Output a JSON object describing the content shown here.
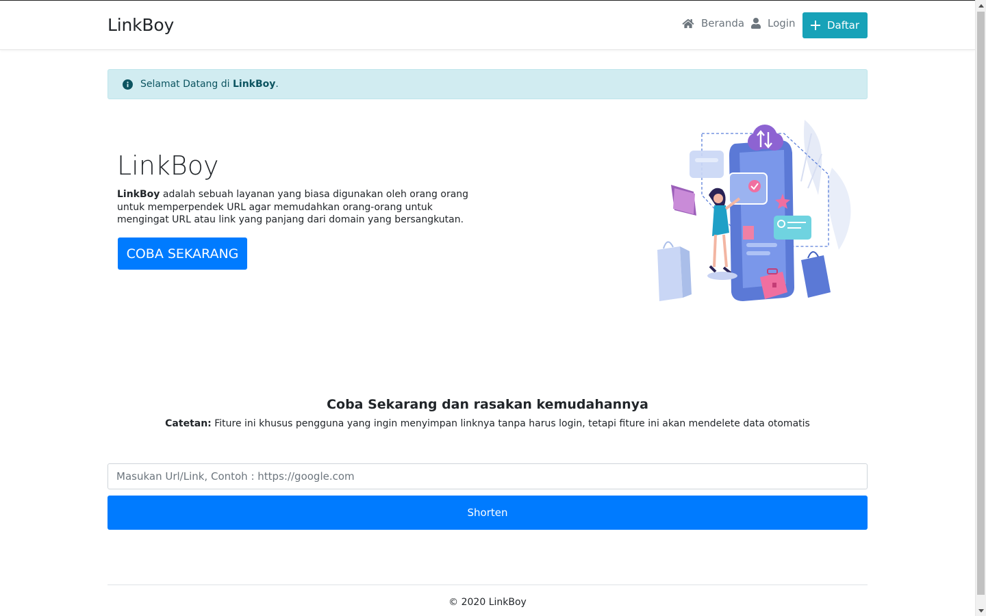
{
  "navbar": {
    "brand": "LinkBoy",
    "home_label": "Beranda",
    "login_label": "Login",
    "register_label": "Daftar"
  },
  "alert": {
    "prefix": "Selamat Datang di ",
    "brand": "LinkBoy",
    "suffix": "."
  },
  "hero": {
    "title": "LinkBoy",
    "text_brand": "LinkBoy",
    "text_body": " adalah sebuah layanan yang biasa digunakan oleh orang orang untuk memperpendek URL agar memudahkan orang-orang untuk mengingat URL atau link yang panjang dari domain yang bersangkutan.",
    "cta_label": "COBA SEKARANG"
  },
  "shorten_section": {
    "title": "Coba Sekarang dan rasakan kemudahannya",
    "note_label": "Catetan:",
    "note_text": " Fiture ini khusus pengguna yang ingin menyimpan linknya tanpa harus login, tetapi fiture ini akan mendelete data otomatis",
    "input_placeholder": "Masukan Url/Link, Contoh : https://google.com",
    "input_value": "",
    "button_label": "Shorten"
  },
  "footer": {
    "copyright": "© 2020 LinkBoy"
  },
  "icons": {
    "home": "home-icon",
    "user": "user-icon",
    "plus": "plus-icon",
    "info": "info-circle-icon"
  },
  "colors": {
    "primary": "#007bff",
    "info": "#17a2b8",
    "alert_bg": "#d1ecf1",
    "alert_text": "#0c5460",
    "muted": "#6c757d"
  }
}
